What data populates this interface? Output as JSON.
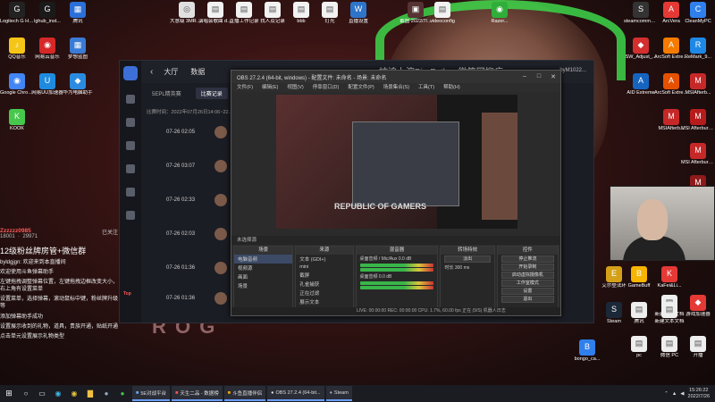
{
  "desktop_icons": [
    {
      "label": "Logitech G HUB",
      "color": "#222222",
      "glyph": "G"
    },
    {
      "label": "lghub_inst...",
      "color": "#1a1a1a",
      "glyph": "G"
    },
    {
      "label": "腾讯",
      "color": "#2b6fd8",
      "glyph": "▦"
    },
    {
      "label": "大意级 3MRSdn...",
      "color": "#e0e0e0",
      "glyph": "◎"
    },
    {
      "label": "演唱会歌曲 demo",
      "color": "#f2f2f2",
      "glyph": "▤"
    },
    {
      "label": "直播工作记录",
      "color": "#f2f2f2",
      "glyph": "▤"
    },
    {
      "label": "找人及记录",
      "color": "#f2f2f2",
      "glyph": "▤"
    },
    {
      "label": "bbb",
      "color": "#f2f2f2",
      "glyph": "▤"
    },
    {
      "label": "灯光",
      "color": "#f2f2f2",
      "glyph": "▤"
    },
    {
      "label": "直播设置",
      "color": "#2e74c9",
      "glyph": "W"
    },
    {
      "label": "截图 2022/7/...",
      "color": "#553333",
      "glyph": "▣"
    },
    {
      "label": "videoconfig",
      "color": "#f2f2f2",
      "glyph": "▤"
    },
    {
      "label": "Razer...",
      "color": "#2fae3a",
      "glyph": "◉"
    },
    {
      "label": "QQ音乐",
      "color": "#f5c518",
      "glyph": "♪"
    },
    {
      "label": "网易云音乐",
      "color": "#d62828",
      "glyph": "◉"
    },
    {
      "label": "梦想蓝图",
      "color": "#3a7bd5",
      "glyph": "▦"
    },
    {
      "label": "Google Chrome",
      "color": "#4285f4",
      "glyph": "◉"
    },
    {
      "label": "网易UU加速器",
      "color": "#1f8be0",
      "glyph": "U"
    },
    {
      "label": "华为电脑助手",
      "color": "#2b8be0",
      "glyph": "◆"
    },
    {
      "label": "KOOK",
      "color": "#46c84c",
      "glyph": "K"
    },
    {
      "label": "steamcommu... 快捷方式",
      "color": "#333333",
      "glyph": "S"
    },
    {
      "label": "ArcVera",
      "color": "#e53935",
      "glyph": "A"
    },
    {
      "label": "CleanMyPC",
      "color": "#2f80ed",
      "glyph": "C"
    },
    {
      "label": "SW_Adjust_...",
      "color": "#d32f2f",
      "glyph": "◆"
    },
    {
      "label": "ArcSoft Extreme",
      "color": "#f57c00",
      "glyph": "A"
    },
    {
      "label": "ReMark_9...",
      "color": "#1e88e5",
      "glyph": "R"
    },
    {
      "label": "AID Extreme",
      "color": "#1565c0",
      "glyph": "A"
    },
    {
      "label": "ArcSoft Extreme",
      "color": "#e65100",
      "glyph": "A"
    },
    {
      "label": "MSIAfterb...",
      "color": "#c62828",
      "glyph": "M"
    },
    {
      "label": "MSIAfterb...",
      "color": "#c62828",
      "glyph": "M"
    },
    {
      "label": "MSI Afterburner",
      "color": "#b71c1c",
      "glyph": "M"
    },
    {
      "label": "MSI Afterburner",
      "color": "#c62828",
      "glyph": "M"
    },
    {
      "label": "Afterburner",
      "color": "#8e1a1a",
      "glyph": "M"
    },
    {
      "label": "艾尔登法环",
      "color": "#d4a017",
      "glyph": "E"
    },
    {
      "label": "KaFei&Li...",
      "color": "#e53935",
      "glyph": "K"
    },
    {
      "label": "GameBuff",
      "color": "#f7b500",
      "glyph": "B"
    },
    {
      "label": "新建文本文档",
      "color": "#eeeeee",
      "glyph": "▤"
    },
    {
      "label": "游戏加速器",
      "color": "#e53935",
      "glyph": "◆"
    },
    {
      "label": "Steam",
      "color": "#1b2838",
      "glyph": "S"
    },
    {
      "label": "腾讯",
      "color": "#eeeeee",
      "glyph": "▤"
    },
    {
      "label": "新建文本文档",
      "color": "#eeeeee",
      "glyph": "▤"
    },
    {
      "label": "bongo_ca...",
      "color": "#2f80ed",
      "glyph": "B"
    },
    {
      "label": "pc",
      "color": "#eeeeee",
      "glyph": "▤"
    },
    {
      "label": "微信 PC",
      "color": "#eeeeee",
      "glyph": "▤"
    },
    {
      "label": "开播",
      "color": "#eeeeee",
      "glyph": "▤"
    }
  ],
  "douyu": {
    "nav": [
      "大厅",
      "数据"
    ],
    "title": "被迫上演Big Father 微笑网抑症zzz",
    "user": "byM1022...",
    "sub_tabs": [
      "5EPL精英赛",
      "比赛记录"
    ],
    "match_time": "比赛时间：2022年07月26日14:06~22...",
    "matches": [
      "07-26 02:05",
      "07-26 03:07",
      "07-26 02:33",
      "07-26 02:03",
      "07-26 01:36",
      "07-26 01:36"
    ],
    "tag": "Top"
  },
  "obs": {
    "title": "OBS 27.2.4 (64-bit, windows) - 配置文件: 未命名 - 场景: 未命名",
    "menu": [
      "文件(F)",
      "编辑(E)",
      "视图(V)",
      "停靠窗口(D)",
      "配置文件(P)",
      "场景集合(S)",
      "工具(T)",
      "帮助(H)"
    ],
    "scene_bar": "未选择源",
    "docks": {
      "scenes": {
        "header": "场景",
        "items": [
          "电脑音频",
          "视频源",
          "画面",
          "场景"
        ]
      },
      "sources": {
        "header": "来源",
        "items": [
          "文本 (GDI+)",
          "mini",
          "截屏",
          "孔雀捕获",
          "正在过滤",
          "展示文本"
        ]
      },
      "mixer": {
        "header": "混音器",
        "rows": [
          "桌面音频 / Mic/Aux  0.0 dB",
          "桌面音频  0.0 dB"
        ]
      },
      "transitions": {
        "header": "转场特效",
        "type": "淡出",
        "duration": "时长 300 ms"
      },
      "controls": {
        "header": "控件",
        "buttons": [
          "停止推流",
          "开始录制",
          "启动虚拟摄像机",
          "工作室模式",
          "设置",
          "退出"
        ]
      }
    },
    "status": "LIVE: 00:00:00   REC: 00:00:00   CPU: 1.7%, 60.00 fps   正在 (9/S)  机器人日志"
  },
  "chat": {
    "room_name": "Zzzzzz0985",
    "level": "已关注",
    "count": "18001",
    "stats": "29971",
    "big_text": "12级粉丝牌房管+微信群",
    "messages": [
      "byldgjgn: 欢迎来到本直播间",
      "欢迎使用斗鱼弹幕助手",
      "左键拖拽调整弹幕位置，左键拖拽边框改变大小，右上角有设置菜单",
      "设置菜单，选择弹幕，滚动鼠标中键，粉丝牌升级等",
      "添加弹幕助手成功",
      "设置展示收到的礼物，道具，贵族开通，贴纸开通",
      "点击单元设置展示礼物类型"
    ]
  },
  "taskbar": {
    "apps": [
      "5E对战平台",
      "天生二品 - 数据榜",
      "斗鱼直播伴侣",
      "OBS 27.2.4 (64-bit...",
      "Steam"
    ],
    "time": "15:26:22",
    "date": "2022/7/26"
  }
}
